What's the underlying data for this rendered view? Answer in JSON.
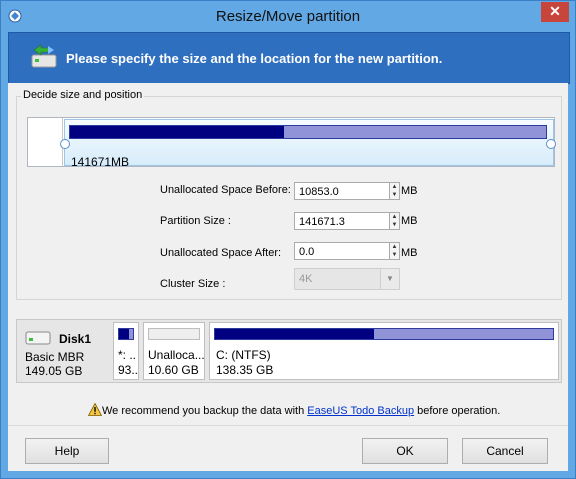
{
  "window": {
    "title": "Resize/Move partition",
    "close_symbol": "✕",
    "title_icon": "app-icon"
  },
  "banner": {
    "text": "Please specify the size and the location for the new partition.",
    "icon": "partition-move-icon"
  },
  "group": {
    "label": "Decide size and position"
  },
  "partition_preview": {
    "size_label": "141671MB",
    "used_fraction": 0.45
  },
  "fields": {
    "unalloc_before": {
      "label": "Unallocated Space Before:",
      "value": "10853.0",
      "unit": "MB"
    },
    "partition_size": {
      "label": "Partition Size :",
      "value": "141671.3",
      "unit": "MB"
    },
    "unalloc_after": {
      "label": "Unallocated Space After:",
      "value": "0.0",
      "unit": "MB"
    },
    "cluster_size": {
      "label": "Cluster Size :",
      "value": "4K"
    }
  },
  "disk": {
    "name": "Disk1",
    "type": "Basic MBR",
    "size": "149.05 GB",
    "partitions": [
      {
        "label": "*: ..",
        "size": "93..."
      },
      {
        "label": "Unalloca...",
        "size": "10.60 GB"
      },
      {
        "label": "C: (NTFS)",
        "size": "138.35 GB",
        "used_fraction": 0.47
      }
    ]
  },
  "warning": {
    "before": "We recommend you backup the data with ",
    "link": "EaseUS Todo Backup",
    "after": " before operation."
  },
  "buttons": {
    "help": "Help",
    "ok": "OK",
    "cancel": "Cancel"
  },
  "colors": {
    "title_bar": "#62a8e5",
    "banner": "#2f6fbf",
    "partition_used": "#000080",
    "partition_free": "#9093d8"
  }
}
